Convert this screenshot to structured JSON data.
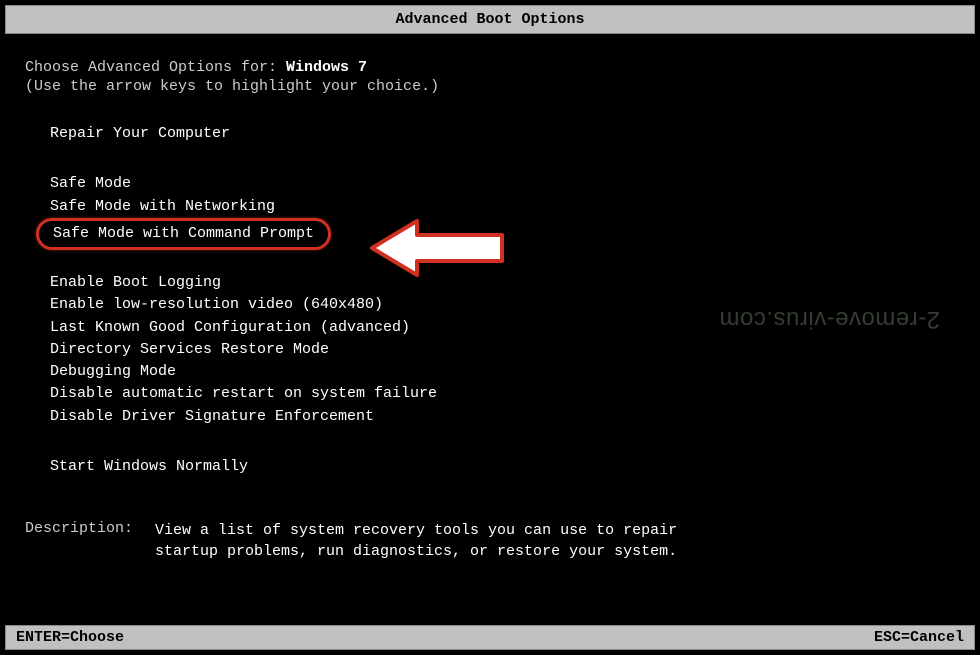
{
  "title": "Advanced Boot Options",
  "prompt": {
    "prefix": "Choose Advanced Options for: ",
    "os": "Windows 7",
    "hint": "(Use the arrow keys to highlight your choice.)"
  },
  "options": {
    "repair": "Repair Your Computer",
    "safe": "Safe Mode",
    "safe_net": "Safe Mode with Networking",
    "safe_cmd": "Safe Mode with Command Prompt",
    "boot_log": "Enable Boot Logging",
    "lowres": "Enable low-resolution video (640x480)",
    "lkgc": "Last Known Good Configuration (advanced)",
    "ds_restore": "Directory Services Restore Mode",
    "debug": "Debugging Mode",
    "no_auto_restart": "Disable automatic restart on system failure",
    "no_driver_sig": "Disable Driver Signature Enforcement",
    "start_normal": "Start Windows Normally"
  },
  "description": {
    "label": "Description:",
    "text": "View a list of system recovery tools you can use to repair startup problems, run diagnostics, or restore your system."
  },
  "footer": {
    "enter": "ENTER=Choose",
    "esc": "ESC=Cancel"
  },
  "watermark": "2-remove-virus.com",
  "highlight_color": "#d03020"
}
